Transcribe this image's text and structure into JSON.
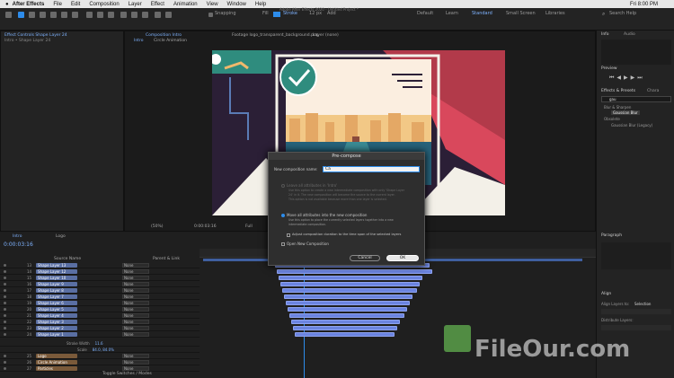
{
  "menubar": {
    "app": "After Effects",
    "items": [
      "File",
      "Edit",
      "Composition",
      "Layer",
      "Effect",
      "Animation",
      "View",
      "Window",
      "Help"
    ],
    "clock": "Fri 8:00 PM"
  },
  "toolbar": {
    "snapping": "Snapping",
    "fill": "Fill",
    "stroke": "Stroke",
    "stroke_px": "12 px",
    "add": "Add",
    "title": "Adobe After Effects 2020 - Untitled Project *",
    "workspaces": [
      "Default",
      "Learn",
      "Standard",
      "Small Screen",
      "Libraries"
    ],
    "search_placeholder": "Search Help"
  },
  "project": {
    "effect_controls_tab": "Effect Controls Shape Layer 24",
    "subtitle": "Intro • Shape Layer 24"
  },
  "composition": {
    "tab": "Composition Intro",
    "subtabs": [
      "Intro",
      "Circle Animation"
    ],
    "footage_tab": "Footage logo_transparent_background.png",
    "layer_tab": "Layer (none)",
    "zoom": "(50%)",
    "timecode": "0:00:03:16",
    "quality": "Full"
  },
  "dialog": {
    "title": "Pre-compose",
    "name_label": "New composition name:",
    "name_value": "Ca",
    "option1": "Leave all attributes in 'Intro'",
    "option1_desc1": "Use this option to create a new intermediate composition with only 'Shape Layer",
    "option1_desc2": "24' in it. The new composition will become the source to the current layer.",
    "option1_desc3": "This option is not available because more than one layer is selected.",
    "option2": "Move all attributes into the new composition",
    "option2_desc1": "Use this option to place the currently selected layers together into a new",
    "option2_desc2": "intermediate composition.",
    "adjust": "Adjust composition duration to the time span of the selected layers",
    "open_new": "Open New Composition",
    "cancel": "Cancel",
    "ok": "OK"
  },
  "timeline": {
    "tabs": [
      "Intro",
      "Logo"
    ],
    "timecode": "0:00:03:16",
    "header": "Source Name",
    "parent_header": "Parent & Link",
    "layers": [
      {
        "num": "13",
        "name": "Shape Layer 13",
        "parent": "None"
      },
      {
        "num": "14",
        "name": "Shape Layer 12",
        "parent": "None"
      },
      {
        "num": "15",
        "name": "Shape Layer 10",
        "parent": "None"
      },
      {
        "num": "16",
        "name": "Shape Layer 9",
        "parent": "None"
      },
      {
        "num": "17",
        "name": "Shape Layer 8",
        "parent": "None"
      },
      {
        "num": "18",
        "name": "Shape Layer 7",
        "parent": "None"
      },
      {
        "num": "19",
        "name": "Shape Layer 6",
        "parent": "None"
      },
      {
        "num": "20",
        "name": "Shape Layer 5",
        "parent": "None"
      },
      {
        "num": "21",
        "name": "Shape Layer 4",
        "parent": "None"
      },
      {
        "num": "22",
        "name": "Shape Layer 3",
        "parent": "None"
      },
      {
        "num": "23",
        "name": "Shape Layer 2",
        "parent": "None"
      },
      {
        "num": "24",
        "name": "Shape Layer 1",
        "parent": "None"
      }
    ],
    "stroke_width_label": "Stroke Width",
    "stroke_width_value": "11.6",
    "scale_label": "Scale",
    "scale_value": "84.0, 84.0%",
    "bottom_layers": [
      {
        "num": "25",
        "name": "Logo",
        "parent": "None"
      },
      {
        "num": "26",
        "name": "Circle Animation",
        "parent": "None"
      },
      {
        "num": "27",
        "name": "Particles",
        "parent": "None"
      }
    ],
    "toggle": "Toggle Switches / Modes"
  },
  "right_panel": {
    "info_tab": "Info",
    "audio_tab": "Audio",
    "preview_tab": "Preview",
    "effects_tab": "Effects & Presets",
    "chars_tab": "Chara",
    "search_value": "gau",
    "blur_sharpen": "Blur & Sharpen",
    "gaussian": "Gaussian Blur",
    "obsolete": "Obsolete",
    "gaussian_legacy": "Gaussian Blur (Legacy)",
    "paragraph": "Paragraph",
    "align": "Align",
    "align_layers_to": "Align Layers to:",
    "selection": "Selection",
    "distribute": "Distribute Layers:"
  },
  "watermark": "FileOur.com",
  "colors": {
    "accent": "#2d8ceb",
    "layer_bar": "#6b84e0",
    "comp_bg": "#2b1f36"
  }
}
